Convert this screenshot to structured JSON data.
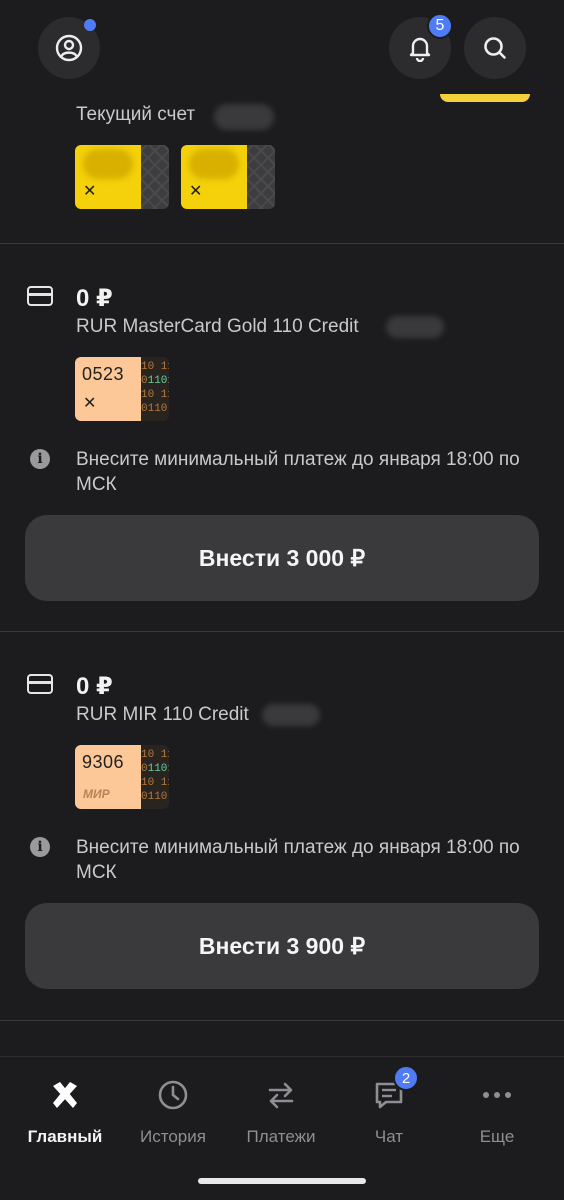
{
  "header": {
    "notifications_count": "5"
  },
  "account": {
    "label": "Текущий счет"
  },
  "credit_cards": [
    {
      "balance": "0 ₽",
      "name": "RUR MasterCard Gold 110 Credit",
      "card_last4": "0523",
      "notice": "Внесите минимальный платеж до        января 18:00 по МСК",
      "pay_button": "Внести 3 000 ₽"
    },
    {
      "balance": "0 ₽",
      "name": "RUR MIR 110 Credit",
      "card_last4": "9306",
      "card_brand": "МИР",
      "notice": "Внесите минимальный платеж до        января 18:00 по МСК",
      "pay_button": "Внести 3 900 ₽"
    }
  ],
  "bottom_nav": [
    {
      "label": "Главный",
      "icon": "bank-logo-icon",
      "active": true
    },
    {
      "label": "История",
      "icon": "clock-icon"
    },
    {
      "label": "Платежи",
      "icon": "transfer-arrows-icon"
    },
    {
      "label": "Чат",
      "icon": "chat-icon",
      "badge": "2"
    },
    {
      "label": "Еще",
      "icon": "more-dots-icon"
    }
  ],
  "colors": {
    "background": "#1c1c1e",
    "accent_badge": "#4f7cf6",
    "card_yellow": "#f4d10a",
    "card_peach": "#fcc898"
  }
}
